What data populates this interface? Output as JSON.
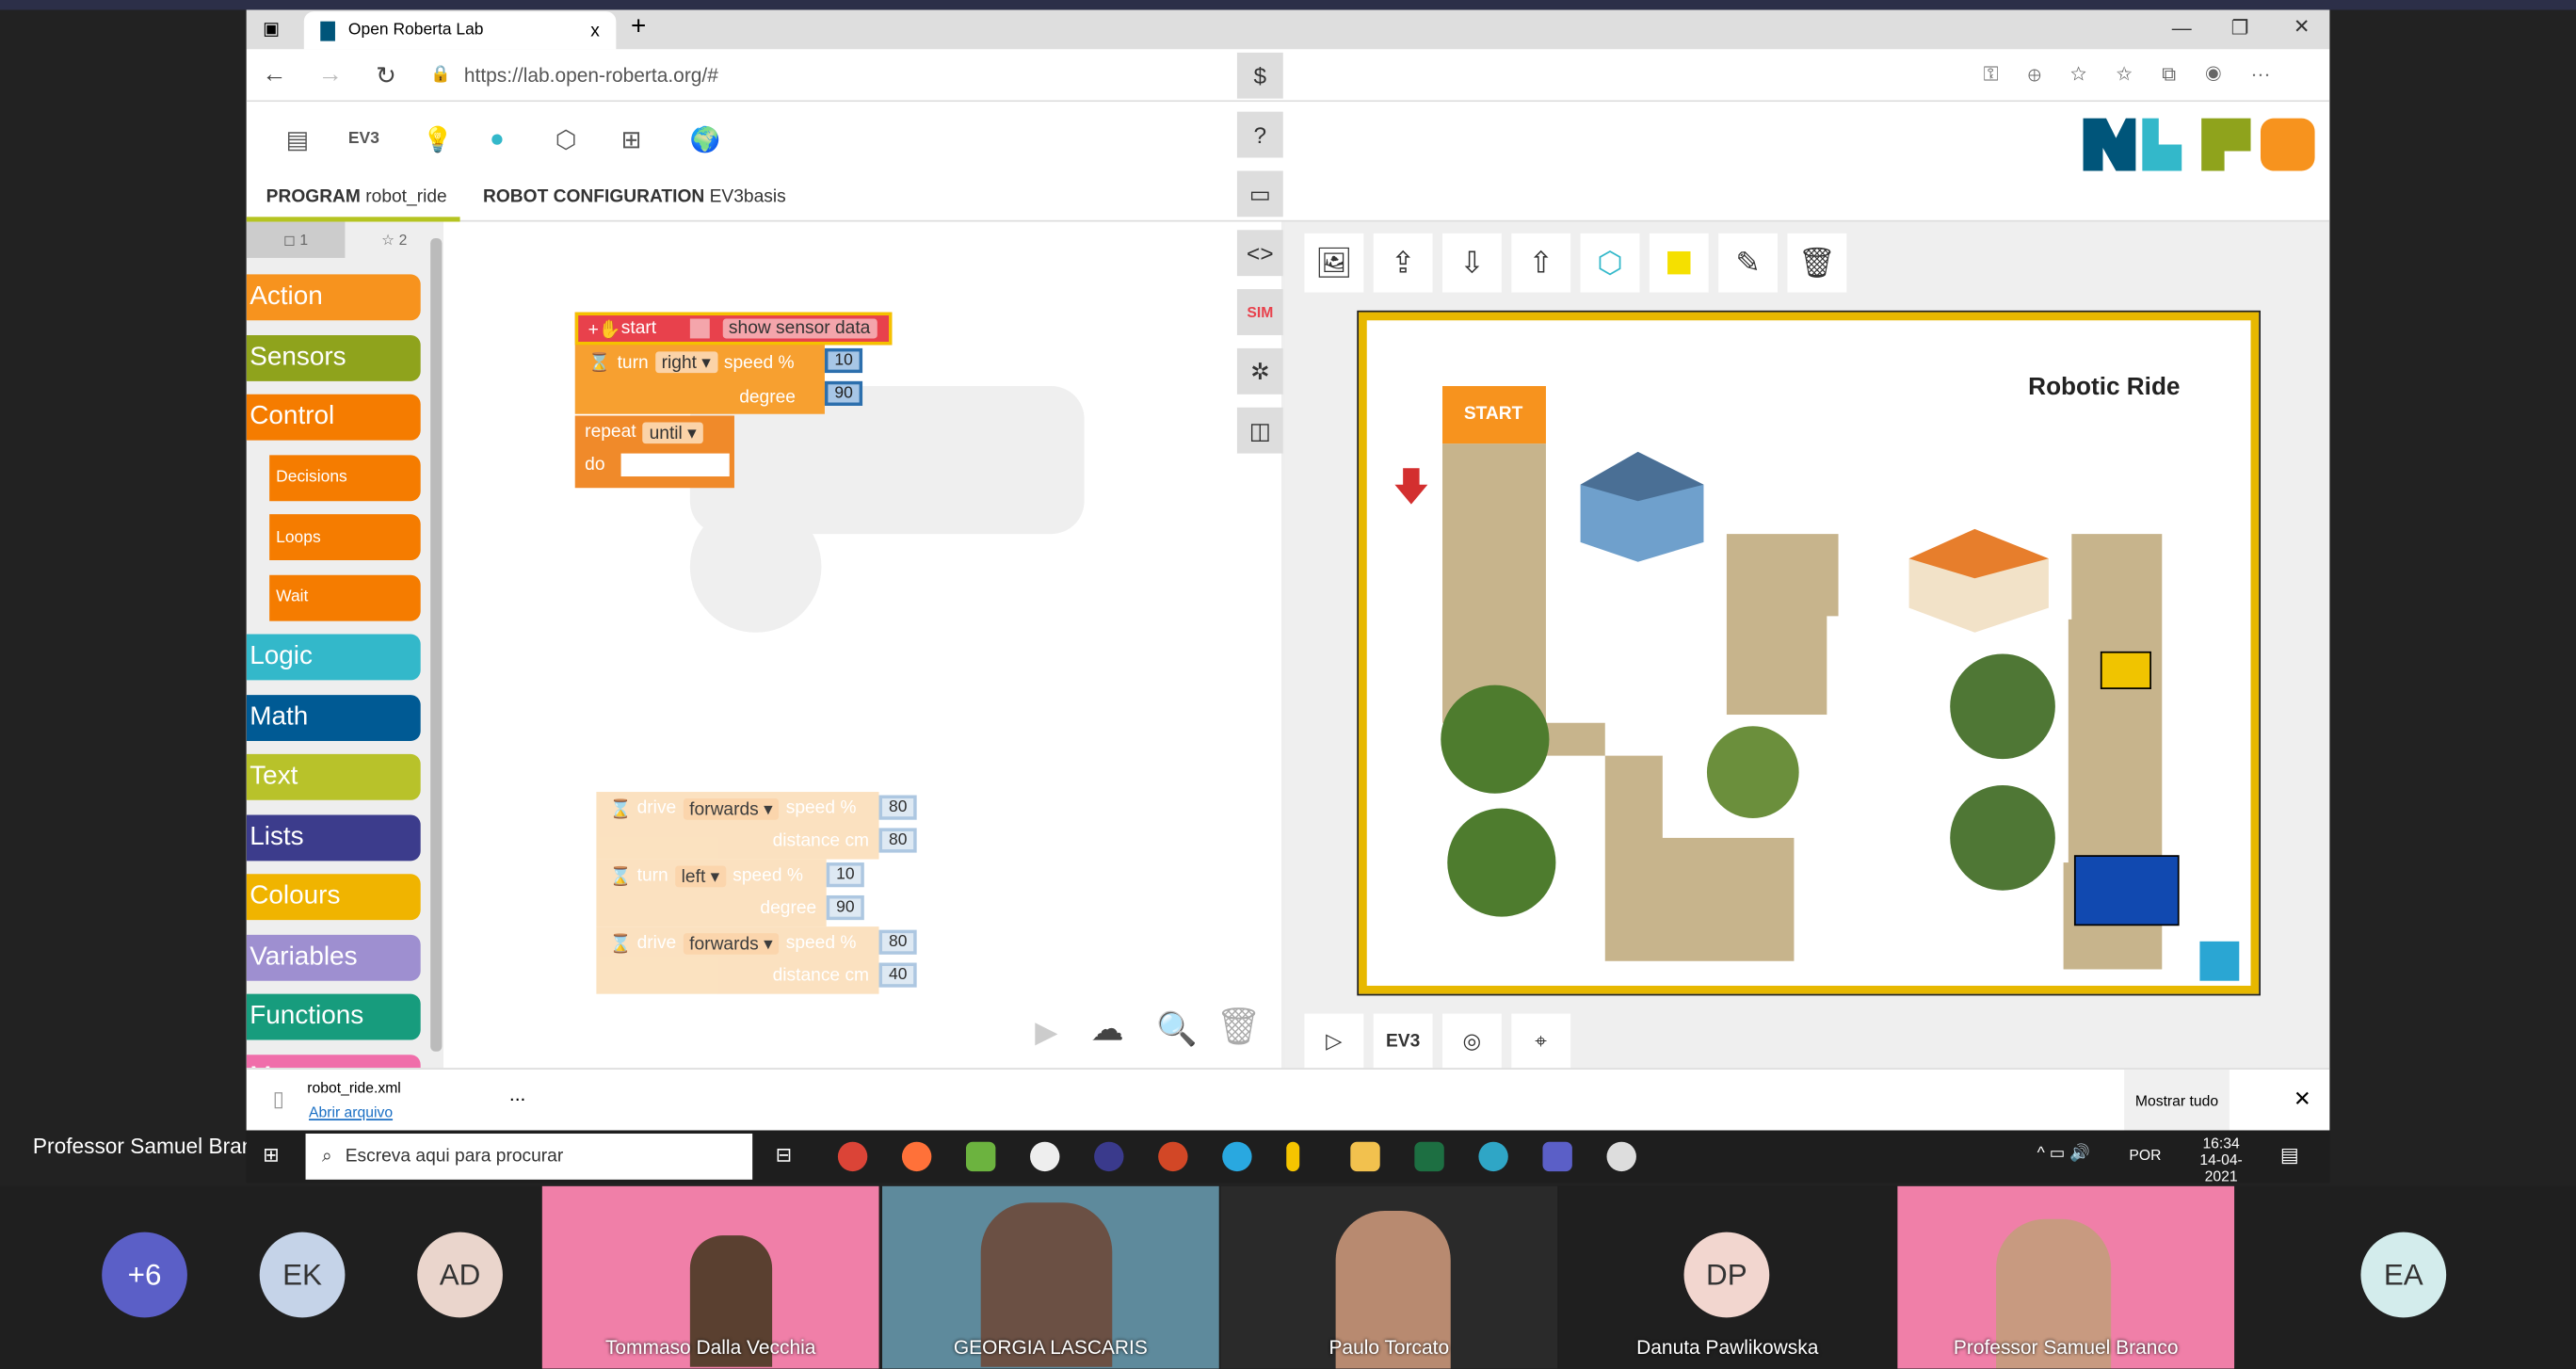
{
  "browser": {
    "tab_title": "Open Roberta Lab",
    "url": "https://lab.open-roberta.org/#",
    "new_tab": "+",
    "close_tab": "x"
  },
  "header": {
    "ev3_label": "EV3",
    "program_label": "PROGRAM",
    "program_name": "robot_ride",
    "config_label": "ROBOT CONFIGURATION",
    "config_name": "EV3basis",
    "logo_colors": [
      "#00557a",
      "#33b8ca",
      "#8fa31c",
      "#f7931e"
    ]
  },
  "toolbox": {
    "tabs": [
      "1",
      "2"
    ],
    "categories": [
      {
        "label": "Action",
        "color": "#f7931e",
        "sub": false
      },
      {
        "label": "Sensors",
        "color": "#8fa31c",
        "sub": false
      },
      {
        "label": "Control",
        "color": "#f57c00",
        "sub": false
      },
      {
        "label": "Decisions",
        "color": "#f57c00",
        "sub": true
      },
      {
        "label": "Loops",
        "color": "#f57c00",
        "sub": true
      },
      {
        "label": "Wait",
        "color": "#f57c00",
        "sub": true
      },
      {
        "label": "Logic",
        "color": "#33b8ca",
        "sub": false
      },
      {
        "label": "Math",
        "color": "#005a94",
        "sub": false
      },
      {
        "label": "Text",
        "color": "#b8c22a",
        "sub": false
      },
      {
        "label": "Lists",
        "color": "#3c3c8c",
        "sub": false
      },
      {
        "label": "Colours",
        "color": "#f0b400",
        "sub": false
      },
      {
        "label": "Variables",
        "color": "#9e8fd0",
        "sub": false
      },
      {
        "label": "Functions",
        "color": "#179c7d",
        "sub": false
      },
      {
        "label": "Messages",
        "color": "#f06eaa",
        "sub": false
      }
    ]
  },
  "program": {
    "start": {
      "label": "start",
      "checkbox_label": "show sensor data"
    },
    "turn1": {
      "label": "turn",
      "dir": "right",
      "speed_label": "speed %",
      "speed": "10",
      "degree_label": "degree",
      "degree": "90"
    },
    "repeat": {
      "label": "repeat",
      "mode": "until",
      "do_label": "do"
    },
    "disabled": [
      {
        "label": "drive",
        "dir": "forwards",
        "p1": "speed %",
        "v1": "80",
        "p2": "distance cm",
        "v2": "80"
      },
      {
        "label": "turn",
        "dir": "left",
        "p1": "speed %",
        "v1": "10",
        "p2": "degree",
        "v2": "90"
      },
      {
        "label": "drive",
        "dir": "forwards",
        "p1": "speed %",
        "v1": "80",
        "p2": "distance cm",
        "v2": "40"
      }
    ]
  },
  "sidebuttons": {
    "sim_label": "SIM"
  },
  "simulation": {
    "title": "Robotic Ride",
    "start_label": "START",
    "ev3_label": "EV3"
  },
  "download": {
    "filename": "robot_ride.xml",
    "open_link": "Abrir arquivo",
    "more": "...",
    "show_all": "Mostrar tudo"
  },
  "taskbar": {
    "search_placeholder": "Escreva aqui para procurar",
    "lang": "POR",
    "time": "16:34",
    "date": "14-04-2021"
  },
  "meeting": {
    "presenter": "Professor Samuel Branco",
    "overflow": "+6",
    "avatars": [
      {
        "initials": "EK",
        "bg": "#c5d3e8"
      },
      {
        "initials": "AD",
        "bg": "#ead5cc"
      },
      {
        "initials": "DP",
        "bg": "#f2d6cf"
      },
      {
        "initials": "EA",
        "bg": "#d3ecec"
      }
    ],
    "tiles": [
      "Tommaso Dalla Vecchia",
      "GEORGIA LASCARIS",
      "Paulo Torcato",
      "Danuta Pawlikowska",
      "Professor Samuel Branco"
    ]
  }
}
